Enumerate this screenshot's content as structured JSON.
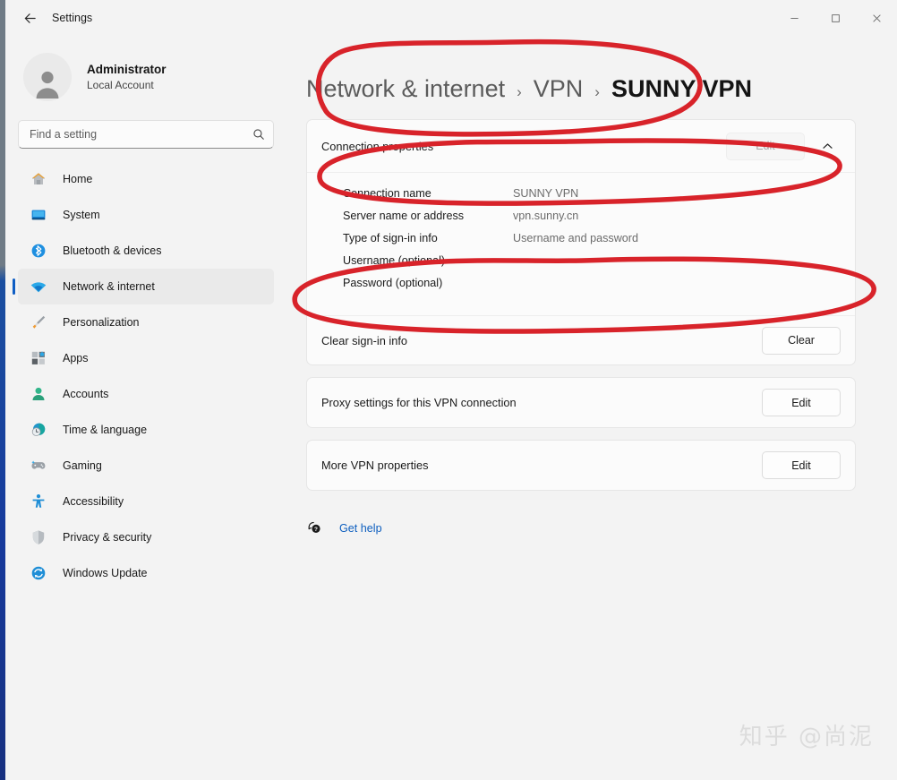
{
  "window": {
    "title": "Settings",
    "back_label": "Back",
    "controls": {
      "minimize": "Minimize",
      "maximize": "Maximize",
      "close": "Close"
    }
  },
  "sidebar": {
    "account": {
      "name": "Administrator",
      "subtitle": "Local Account"
    },
    "search": {
      "placeholder": "Find a setting",
      "value": ""
    },
    "items": [
      {
        "label": "Home",
        "icon": "home-icon",
        "active": false
      },
      {
        "label": "System",
        "icon": "system-icon",
        "active": false
      },
      {
        "label": "Bluetooth & devices",
        "icon": "bluetooth-icon",
        "active": false
      },
      {
        "label": "Network & internet",
        "icon": "wifi-icon",
        "active": true
      },
      {
        "label": "Personalization",
        "icon": "brush-icon",
        "active": false
      },
      {
        "label": "Apps",
        "icon": "apps-icon",
        "active": false
      },
      {
        "label": "Accounts",
        "icon": "account-icon",
        "active": false
      },
      {
        "label": "Time & language",
        "icon": "clock-icon",
        "active": false
      },
      {
        "label": "Gaming",
        "icon": "gamepad-icon",
        "active": false
      },
      {
        "label": "Accessibility",
        "icon": "accessibility-icon",
        "active": false
      },
      {
        "label": "Privacy & security",
        "icon": "shield-icon",
        "active": false
      },
      {
        "label": "Windows Update",
        "icon": "update-icon",
        "active": false
      }
    ]
  },
  "breadcrumb": {
    "root": "Network & internet",
    "separator": "›",
    "middle": "VPN",
    "current": "SUNNY VPN"
  },
  "main": {
    "connection_properties": {
      "title": "Connection properties",
      "edit_label": "Edit",
      "edit_disabled": true,
      "collapse_icon": "chevron-up-icon",
      "details": [
        {
          "key": "Connection name",
          "value": "SUNNY VPN"
        },
        {
          "key": "Server name or address",
          "value": "vpn.sunny.cn"
        },
        {
          "key": "Type of sign-in info",
          "value": "Username and password"
        },
        {
          "key": "Username (optional)",
          "value": ""
        },
        {
          "key": "Password (optional)",
          "value": ""
        }
      ],
      "clear_row": {
        "label": "Clear sign-in info",
        "button": "Clear"
      }
    },
    "proxy_row": {
      "label": "Proxy settings for this VPN connection",
      "button": "Edit"
    },
    "more_properties_row": {
      "label": "More VPN properties",
      "button": "Edit"
    },
    "get_help": {
      "label": "Get help",
      "icon": "help-bubble-icon"
    }
  },
  "watermark": {
    "text": "知乎 @尚泥"
  },
  "colors": {
    "accent": "#0f5ec4",
    "link": "#0e5fbf",
    "annotation": "#d8232a",
    "page_bg": "#f3f3f3",
    "card_bg": "#fbfbfb"
  }
}
